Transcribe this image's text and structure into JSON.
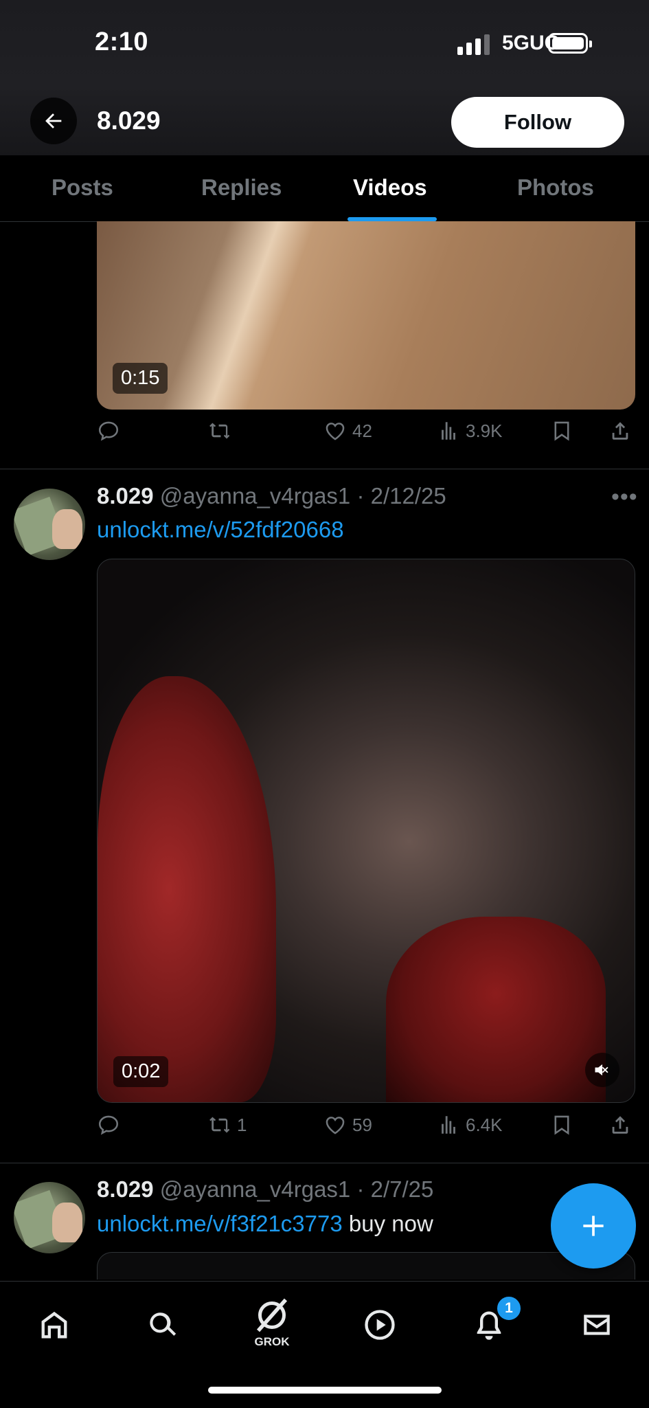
{
  "status_bar": {
    "time": "2:10",
    "network": "5GUC"
  },
  "header": {
    "title": "8.029",
    "follow_label": "Follow"
  },
  "tabs": [
    {
      "label": "Posts",
      "active": false
    },
    {
      "label": "Replies",
      "active": false
    },
    {
      "label": "Videos",
      "active": true
    },
    {
      "label": "Photos",
      "active": false
    }
  ],
  "post1": {
    "video_duration": "0:15",
    "likes": "42",
    "views": "3.9K"
  },
  "post2": {
    "name": "8.029",
    "handle": "@ayanna_v4rgas1",
    "date": "2/12/25",
    "link": "unlockt.me/v/52fdf20668",
    "video_duration": "0:02",
    "reposts": "1",
    "likes": "59",
    "views": "6.4K"
  },
  "post3": {
    "name": "8.029",
    "handle": "@ayanna_v4rgas1",
    "date": "2/7/25",
    "link": "unlockt.me/v/f3f21c3773",
    "text_after_link": " buy now"
  },
  "bottom_nav": {
    "grok_label": "GROK",
    "notification_count": "1"
  },
  "colors": {
    "accent": "#1d9bf0",
    "muted": "#71767b",
    "background": "#000000"
  }
}
